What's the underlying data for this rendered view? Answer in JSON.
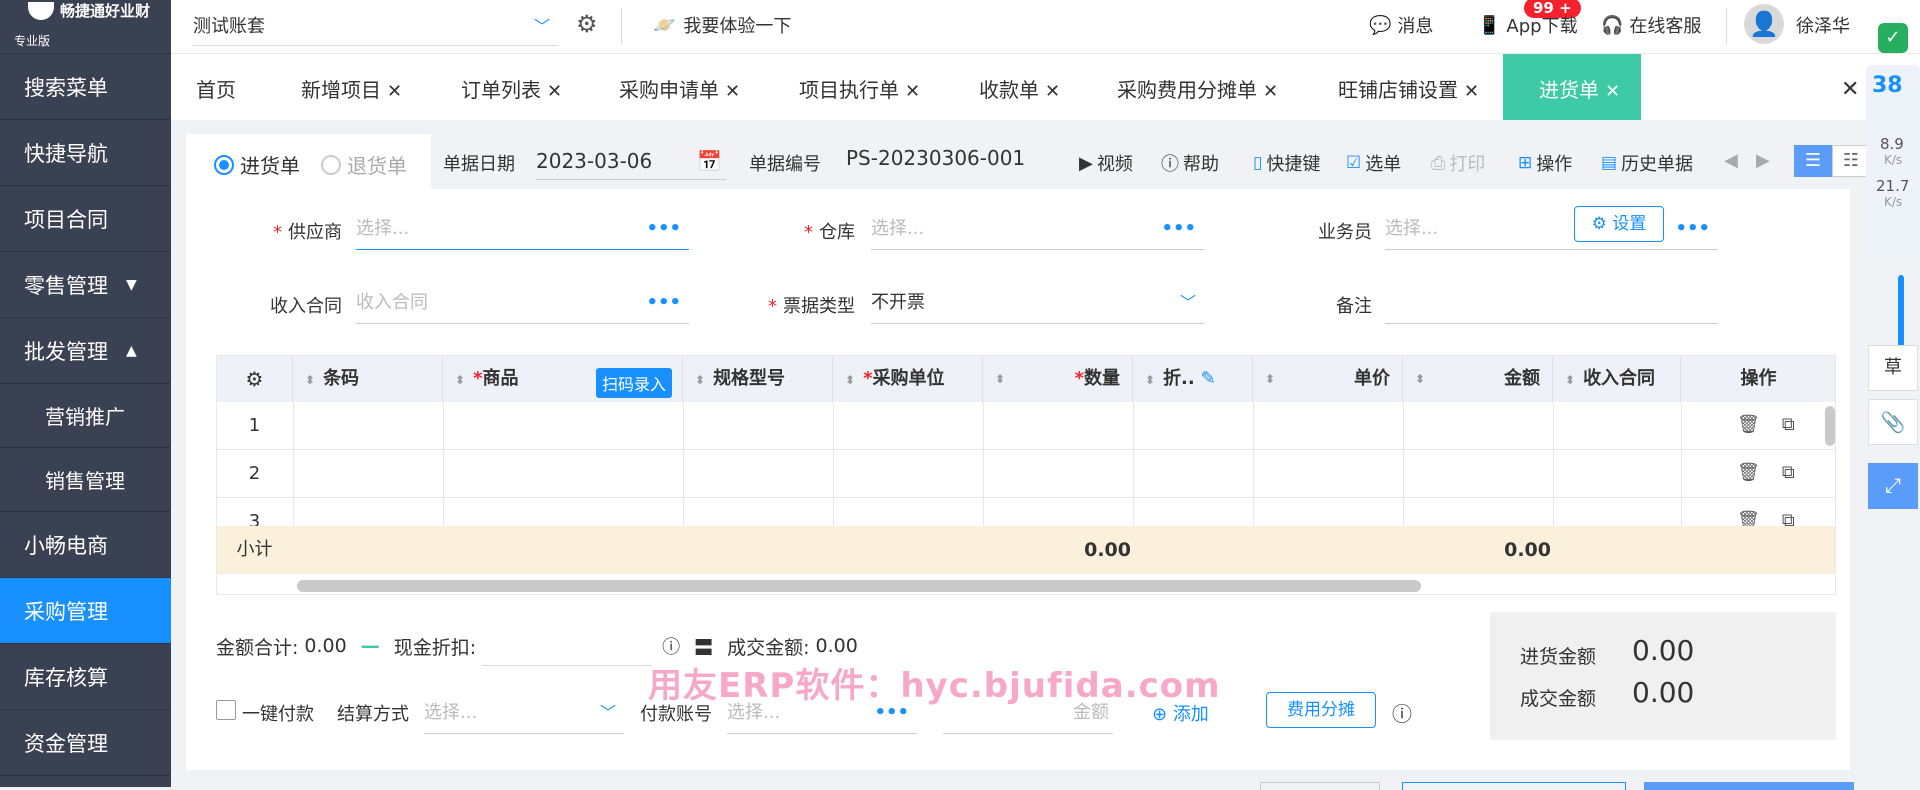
{
  "sidebar": {
    "brand": "畅捷通好业财",
    "edition": "专业版",
    "items": [
      {
        "label": "搜索菜单"
      },
      {
        "label": "快捷导航"
      },
      {
        "label": "项目合同"
      },
      {
        "label": "零售管理",
        "caret": "▼"
      },
      {
        "label": "批发管理",
        "caret": "▲"
      },
      {
        "label": "营销推广"
      },
      {
        "label": "销售管理"
      },
      {
        "label": "小畅电商"
      },
      {
        "label": "采购管理"
      },
      {
        "label": "库存核算"
      },
      {
        "label": "资金管理"
      }
    ],
    "active_index": 8
  },
  "topbar": {
    "account": "测试账套",
    "try_label": "我要体验一下",
    "messages_label": "消息",
    "messages_badge": "99 +",
    "app_download": "App下载",
    "online_service": "在线客服",
    "user_name": "徐泽华"
  },
  "tabs": [
    {
      "label": "首页",
      "closable": false
    },
    {
      "label": "新增项目",
      "closable": true
    },
    {
      "label": "订单列表",
      "closable": true
    },
    {
      "label": "采购申请单",
      "closable": true
    },
    {
      "label": "项目执行单",
      "closable": true
    },
    {
      "label": "收款单",
      "closable": true
    },
    {
      "label": "采购费用分摊单",
      "closable": true
    },
    {
      "label": "旺铺店铺设置",
      "closable": true
    },
    {
      "label": "进货单",
      "closable": true,
      "active": true
    }
  ],
  "doc": {
    "mode_in": "进货单",
    "mode_return": "退货单",
    "date_label": "单据日期",
    "date_value": "2023-03-06",
    "number_label": "单据编号",
    "number_value": "PS-20230306-001"
  },
  "toolbar": {
    "video": "视频",
    "help": "帮助",
    "shortcut": "快捷键",
    "select": "选单",
    "print": "打印",
    "operate": "操作",
    "history": "历史单据"
  },
  "form": {
    "supplier_label": "供应商",
    "supplier_placeholder": "选择...",
    "warehouse_label": "仓库",
    "warehouse_placeholder": "选择...",
    "salesman_label": "业务员",
    "salesman_placeholder": "选择...",
    "contract_label": "收入合同",
    "contract_placeholder": "收入合同",
    "invoice_label": "票据类型",
    "invoice_value": "不开票",
    "remark_label": "备注",
    "settings_label": "设置"
  },
  "grid": {
    "headers": [
      "条码",
      "商品",
      "规格型号",
      "采购单位",
      "数量",
      "折..",
      "单价",
      "金额",
      "收入合同",
      "操作"
    ],
    "scan_label": "扫码录入",
    "rows": [
      "1",
      "2",
      "3"
    ],
    "subtotal_label": "小计",
    "subtotal_qty": "0.00",
    "subtotal_amount": "0.00"
  },
  "totals": {
    "amount_label": "金额合计:",
    "amount_value": "0.00",
    "discount_label": "现金折扣:",
    "deal_label": "成交金额:",
    "deal_value": "0.00",
    "purchase_amount_label": "进货金额",
    "purchase_amount_value": "0.00",
    "deal_amount_label": "成交金额",
    "deal_amount_value": "0.00"
  },
  "payment": {
    "one_click": "一键付款",
    "method_label": "结算方式",
    "method_placeholder": "选择...",
    "account_label": "付款账号",
    "account_placeholder": "选择...",
    "amount_placeholder": "金额",
    "add_label": "添加",
    "fee_label": "费用分摊"
  },
  "watermark": "用友ERP软件：hyc.bjufida.com",
  "rail": {
    "speed_big": "38",
    "up_speed": "8.9",
    "up_unit": "K/s",
    "down_speed": "21.7",
    "down_unit": "K/s",
    "draft": "草"
  },
  "colors": {
    "sidebar_bg": "#394152",
    "active_menu": "#1890ff",
    "active_tab": "#3ec9a7",
    "subtotal_bg": "#fbf0dc"
  }
}
